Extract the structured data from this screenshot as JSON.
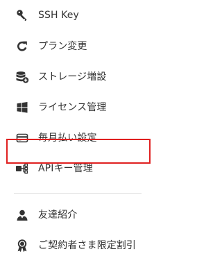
{
  "menu": {
    "items": [
      {
        "label": "SSH Key",
        "icon": "key-icon"
      },
      {
        "label": "プラン変更",
        "icon": "refresh-icon"
      },
      {
        "label": "ストレージ増設",
        "icon": "storage-add-icon"
      },
      {
        "label": "ライセンス管理",
        "icon": "windows-icon"
      },
      {
        "label": "毎月払い設定",
        "icon": "credit-card-icon"
      },
      {
        "label": "APIキー管理",
        "icon": "api-icon"
      },
      {
        "label": "友達紹介",
        "icon": "user-icon"
      },
      {
        "label": "ご契約者さま限定割引",
        "icon": "badge-icon"
      }
    ]
  },
  "colors": {
    "text": "#333333",
    "icon": "#333333",
    "highlight": "#e02020",
    "divider": "#dddddd"
  }
}
